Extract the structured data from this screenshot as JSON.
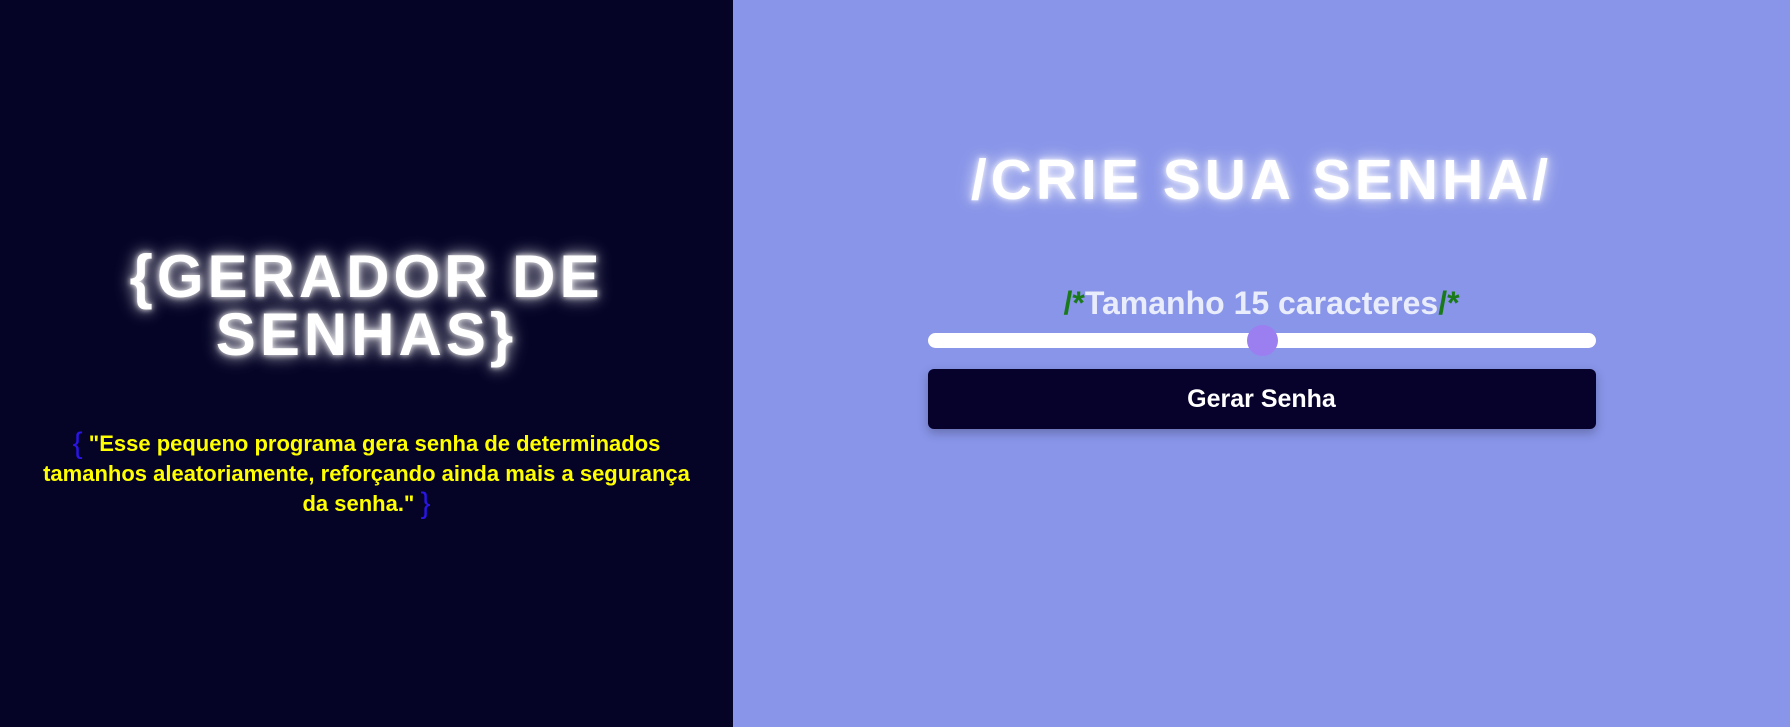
{
  "left": {
    "title": "{GERADOR DE SENHAS}",
    "brace_open": "{",
    "description": "\"Esse pequeno programa gera senha de determinados tamanhos aleatoriamente, reforçando ainda mais a segurança da senha.\"",
    "brace_close": "}"
  },
  "right": {
    "title": "/CRIE SUA SENHA/",
    "length_label": {
      "prefix": "/*",
      "text": "Tamanho 15 caracteres",
      "suffix": "/*"
    },
    "slider": {
      "fraction": 0.5
    },
    "button_label": "Gerar Senha"
  },
  "colors": {
    "left_background": "#050426",
    "right_background": "#8895e9",
    "description_text": "#ffff00",
    "brace": "#2a14e6",
    "marker": "#1a7a1a",
    "slider_thumb": "#9b7ff0",
    "button_background": "#07022b"
  }
}
